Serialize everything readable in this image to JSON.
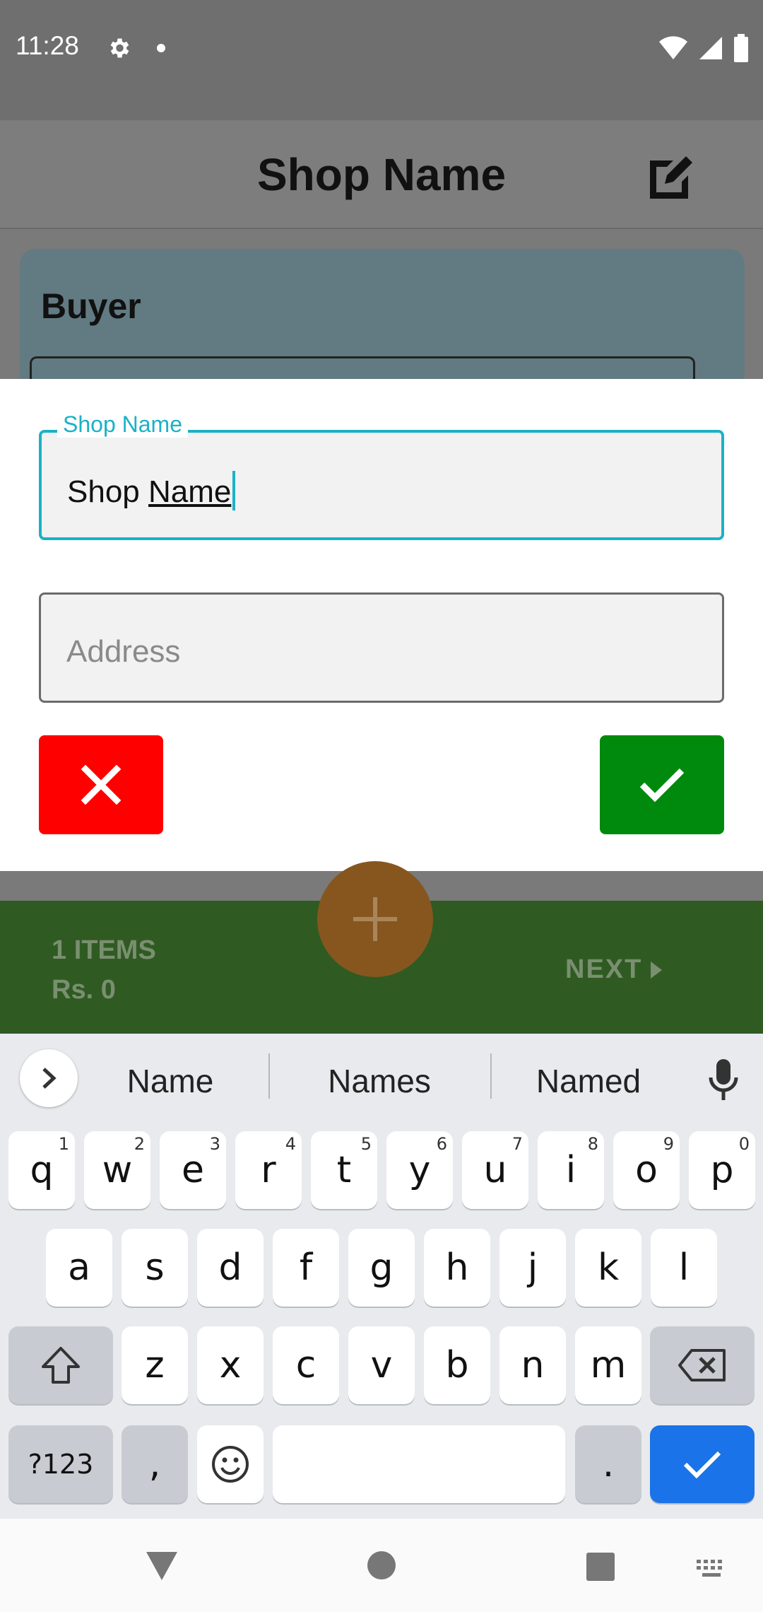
{
  "status_bar": {
    "time": "11:28"
  },
  "app_bar": {
    "title": "Shop Name"
  },
  "background": {
    "buyer_title": "Buyer"
  },
  "dialog": {
    "shop_name_field": {
      "label": "Shop Name",
      "value_prefix": "Shop ",
      "value_underlined": "Name"
    },
    "address_field": {
      "placeholder": "Address"
    }
  },
  "bottom_bar": {
    "items_count": "1 ITEMS",
    "total": "Rs. 0",
    "next_label": "NEXT"
  },
  "keyboard": {
    "suggestions": [
      "Name",
      "Names",
      "Named"
    ],
    "row1": [
      {
        "k": "q",
        "h": "1"
      },
      {
        "k": "w",
        "h": "2"
      },
      {
        "k": "e",
        "h": "3"
      },
      {
        "k": "r",
        "h": "4"
      },
      {
        "k": "t",
        "h": "5"
      },
      {
        "k": "y",
        "h": "6"
      },
      {
        "k": "u",
        "h": "7"
      },
      {
        "k": "i",
        "h": "8"
      },
      {
        "k": "o",
        "h": "9"
      },
      {
        "k": "p",
        "h": "0"
      }
    ],
    "row2": [
      "a",
      "s",
      "d",
      "f",
      "g",
      "h",
      "j",
      "k",
      "l"
    ],
    "row3": [
      "z",
      "x",
      "c",
      "v",
      "b",
      "n",
      "m"
    ],
    "symbols_label": "?123",
    "comma_label": ",",
    "period_label": "."
  },
  "colors": {
    "accent": "#1ab2c6",
    "cancel": "#ff0000",
    "confirm": "#008a0d",
    "bottom_bar": "#2f5b22",
    "fab": "#87561f",
    "keyboard_enter": "#1a73e8"
  }
}
